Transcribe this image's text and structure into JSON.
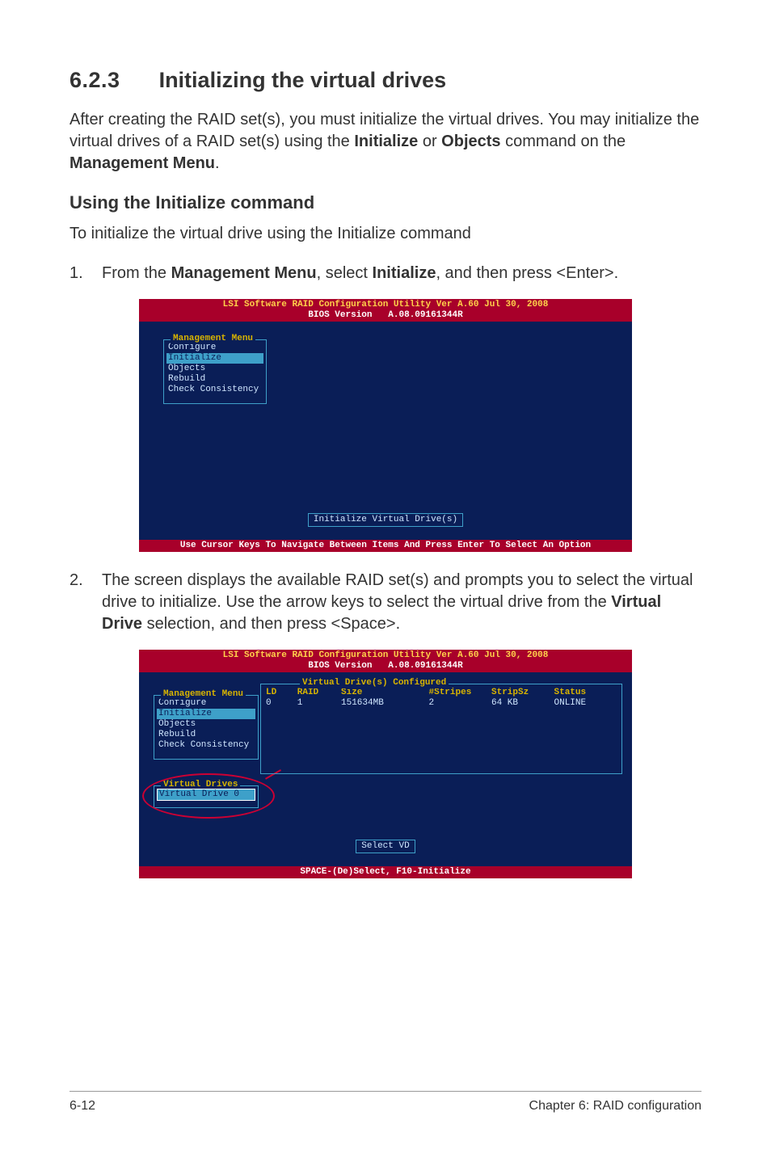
{
  "section": {
    "number": "6.2.3",
    "title": "Initializing the virtual drives"
  },
  "intro": {
    "preBold1": "After creating the RAID set(s), you must initialize the virtual drives. You may initialize the virtual drives of a RAID set(s) using the ",
    "bold1": "Initialize",
    "mid": " or ",
    "bold2": "Objects",
    "postBold2": " command on the ",
    "bold3": "Management Menu",
    "end": "."
  },
  "subhead": "Using the Initialize command",
  "subline": "To initialize the virtual drive using the Initialize command",
  "step1": {
    "num": "1.",
    "pre": "From the ",
    "b1": "Management Menu",
    "mid": ", select ",
    "b2": "Initialize",
    "post": ", and then press <Enter>."
  },
  "bios1": {
    "title_line1a": "LSI Software RAID Configuration Utility Ver A.60 Jul 30, 2008",
    "title_line2": "BIOS Version   A.08.09161344R",
    "menu_label": "Management Menu",
    "items": [
      "Configure",
      "Initialize",
      "Objects",
      "Rebuild",
      "Check Consistency"
    ],
    "selected": "Initialize",
    "center": "Initialize Virtual Drive(s)",
    "bottom": "Use Cursor Keys To Navigate Between Items And Press Enter To Select An Option"
  },
  "step2": {
    "num": "2.",
    "pre": "The screen displays the available RAID set(s) and prompts you to select the virtual drive to initialize. Use the arrow keys to select the virtual drive from the ",
    "b1": "Virtual Drive",
    "post": " selection, and then press <Space>."
  },
  "bios2": {
    "title_line1a": "LSI Software RAID Configuration Utility Ver A.60 Jul 30, 2008",
    "title_line2": "BIOS Version   A.08.09161344R",
    "menu_label": "Management Menu",
    "items": [
      "Configure",
      "Initialize",
      "Objects",
      "Rebuild",
      "Check Consistency"
    ],
    "selected": "Initialize",
    "vd_label": "Virtual Drives",
    "vd_item": "Virtual Drive 0",
    "table_label": "Virtual Drive(s) Configured",
    "headers": [
      "LD",
      "RAID",
      "Size",
      "#Stripes",
      "StripSz",
      "Status"
    ],
    "row": [
      "0",
      "1",
      "151634MB",
      "2",
      "64 KB",
      "ONLINE"
    ],
    "center": "Select VD",
    "bottom": "SPACE-(De)Select,  F10-Initialize"
  },
  "footer": {
    "left": "6-12",
    "right": "Chapter 6: RAID configuration"
  }
}
